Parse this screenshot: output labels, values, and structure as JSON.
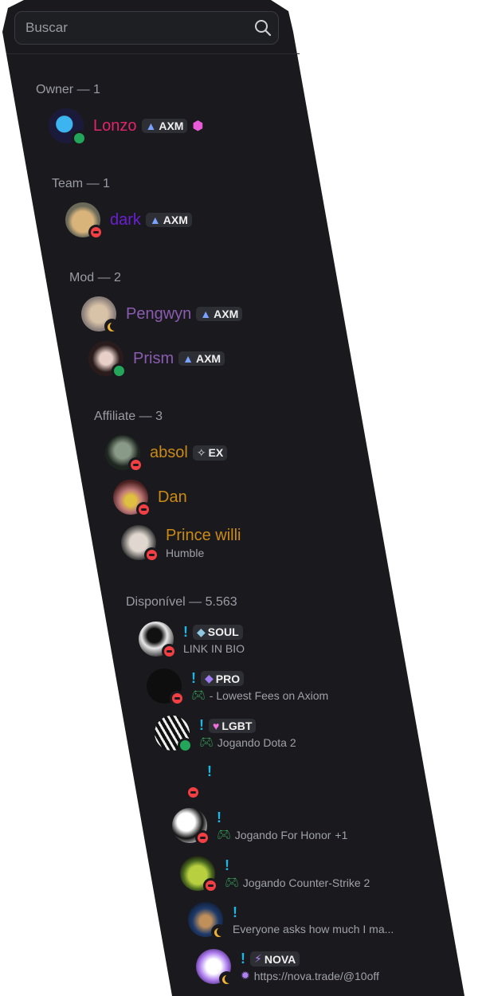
{
  "search": {
    "placeholder": "Buscar"
  },
  "colors": {
    "online": "#23a55a",
    "dnd": "#f23f43",
    "idle": "#f0b232",
    "owner": "#e0246a",
    "team": "#6a1fd1",
    "mod": "#8a5cb0",
    "affiliate": "#c98a16",
    "exclaim": "#1fb6e6"
  },
  "groups": [
    {
      "title": "Owner — 1",
      "members": [
        {
          "name": "Lonzo",
          "badge": "AXM",
          "status": "online"
        }
      ]
    },
    {
      "title": "Team — 1",
      "members": [
        {
          "name": "dark",
          "badge": "AXM",
          "status": "dnd"
        }
      ]
    },
    {
      "title": "Mod — 2",
      "members": [
        {
          "name": "Pengwyn",
          "badge": "AXM",
          "status": "idle"
        },
        {
          "name": "Prism",
          "badge": "AXM",
          "status": "online"
        }
      ]
    },
    {
      "title": "Affiliate — 3",
      "members": [
        {
          "name": "absol",
          "badge": "EX",
          "status": "dnd"
        },
        {
          "name": "Dan",
          "status": "dnd"
        },
        {
          "name": "Prince willi",
          "sub": "Humble",
          "status": "dnd"
        }
      ]
    },
    {
      "title": "Disponível — 5.563",
      "members": [
        {
          "name": "!",
          "badge": "SOUL",
          "sub": "LINK IN BIO",
          "status": "dnd"
        },
        {
          "name": "!",
          "badge": "PRO",
          "sub": "- Lowest Fees on Axiom",
          "status": "dnd"
        },
        {
          "name": "!",
          "badge": "LGBT",
          "sub": "Jogando Dota 2",
          "status": "online"
        },
        {
          "name": "!",
          "status": "dnd"
        },
        {
          "name": "!",
          "sub": "Jogando For Honor",
          "extra": "+1",
          "status": "dnd"
        },
        {
          "name": "!",
          "sub": "Jogando Counter-Strike 2",
          "status": "dnd"
        },
        {
          "name": "!",
          "sub": "Everyone asks how much I ma...",
          "status": "idle"
        },
        {
          "name": "!",
          "badge": "NOVA",
          "sub": "https://nova.trade/@10off",
          "status": "idle"
        }
      ]
    }
  ]
}
